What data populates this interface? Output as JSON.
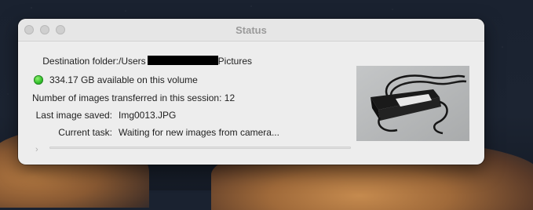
{
  "window": {
    "title": "Status"
  },
  "status": {
    "destination_label": "Destination folder:",
    "destination_prefix": "/Users",
    "destination_suffix": "Pictures",
    "available_text": "334.17 GB available on this volume",
    "available_status_color": "#2fbf2a",
    "transferred_label": "Number of images transferred in this session:",
    "transferred_count": "12",
    "last_saved_label": "Last image saved:",
    "last_saved_value": "Img0013.JPG",
    "current_task_label": "Current task:",
    "current_task_value": "Waiting for new images from camera..."
  },
  "progress": {
    "fraction": 0
  },
  "icons": {
    "disclosure": "chevron-right-icon",
    "status": "green-status-icon"
  }
}
